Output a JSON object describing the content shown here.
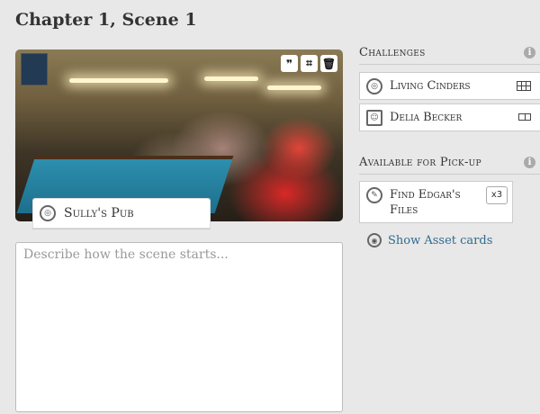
{
  "page": {
    "title": "Chapter 1, Scene 1"
  },
  "scene": {
    "image_tools": [
      {
        "icon": "quote-icon",
        "glyph": "❞"
      },
      {
        "icon": "crop-icon",
        "glyph": "⌗"
      },
      {
        "icon": "trash-icon",
        "glyph": "🗑"
      }
    ],
    "location": {
      "icon": "location-icon",
      "label": "Sully's Pub"
    },
    "description": {
      "placeholder": "Describe how the scene starts...",
      "value": ""
    }
  },
  "challenges": {
    "title": "Challenges",
    "items": [
      {
        "label": "Living Cinders",
        "icon": "target-icon",
        "type_icon": "grid-icon"
      },
      {
        "label": "Delia Becker",
        "icon": "portrait-icon",
        "type_icon": "box-icon"
      }
    ]
  },
  "pickup": {
    "title": "Available for Pick-up",
    "items": [
      {
        "label_line1": "Find Edgar's",
        "label_line2": "Files",
        "icon": "clue-icon",
        "count": "x3"
      }
    ]
  },
  "asset_link": {
    "label": "Show Asset cards",
    "icon": "asset-icon"
  }
}
